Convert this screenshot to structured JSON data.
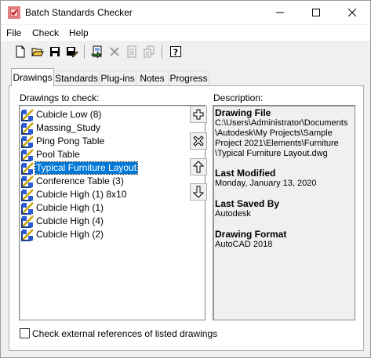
{
  "window": {
    "title": "Batch Standards Checker"
  },
  "menu": [
    "File",
    "Check",
    "Help"
  ],
  "tabs": [
    "Drawings",
    "Standards",
    "Plug-ins",
    "Notes",
    "Progress"
  ],
  "active_tab": "Drawings",
  "drawings_panel": {
    "label": "Drawings to check:",
    "items": [
      "Cubicle Low (8)",
      "Massing_Study",
      "Ping Pong Table",
      "Pool Table",
      "Typical Furniture Layout",
      "Conference Table (3)",
      "Cubicle High (1) 8x10",
      "Cubicle High (1)",
      "Cubicle High (4)",
      "Cubicle High (2)"
    ],
    "selected": "Typical Furniture Layout"
  },
  "description": {
    "label": "Description:",
    "sections": [
      {
        "heading": "Drawing File",
        "value": "C:\\Users\\Administrator\\Documents\n\\Autodesk\\My Projects\\Sample\nProject 2021\\Elements\\Furniture\n\\Typical Furniture Layout.dwg"
      },
      {
        "heading": "Last Modified",
        "value": "Monday, January 13, 2020"
      },
      {
        "heading": "Last Saved By",
        "value": "Autodesk"
      },
      {
        "heading": "Drawing Format",
        "value": "AutoCAD 2018"
      }
    ]
  },
  "xref_checkbox": {
    "label": "Check external references of listed drawings",
    "checked": false
  },
  "colors": {
    "selection": "#0078d7",
    "window_bg": "#f0f0f0"
  }
}
